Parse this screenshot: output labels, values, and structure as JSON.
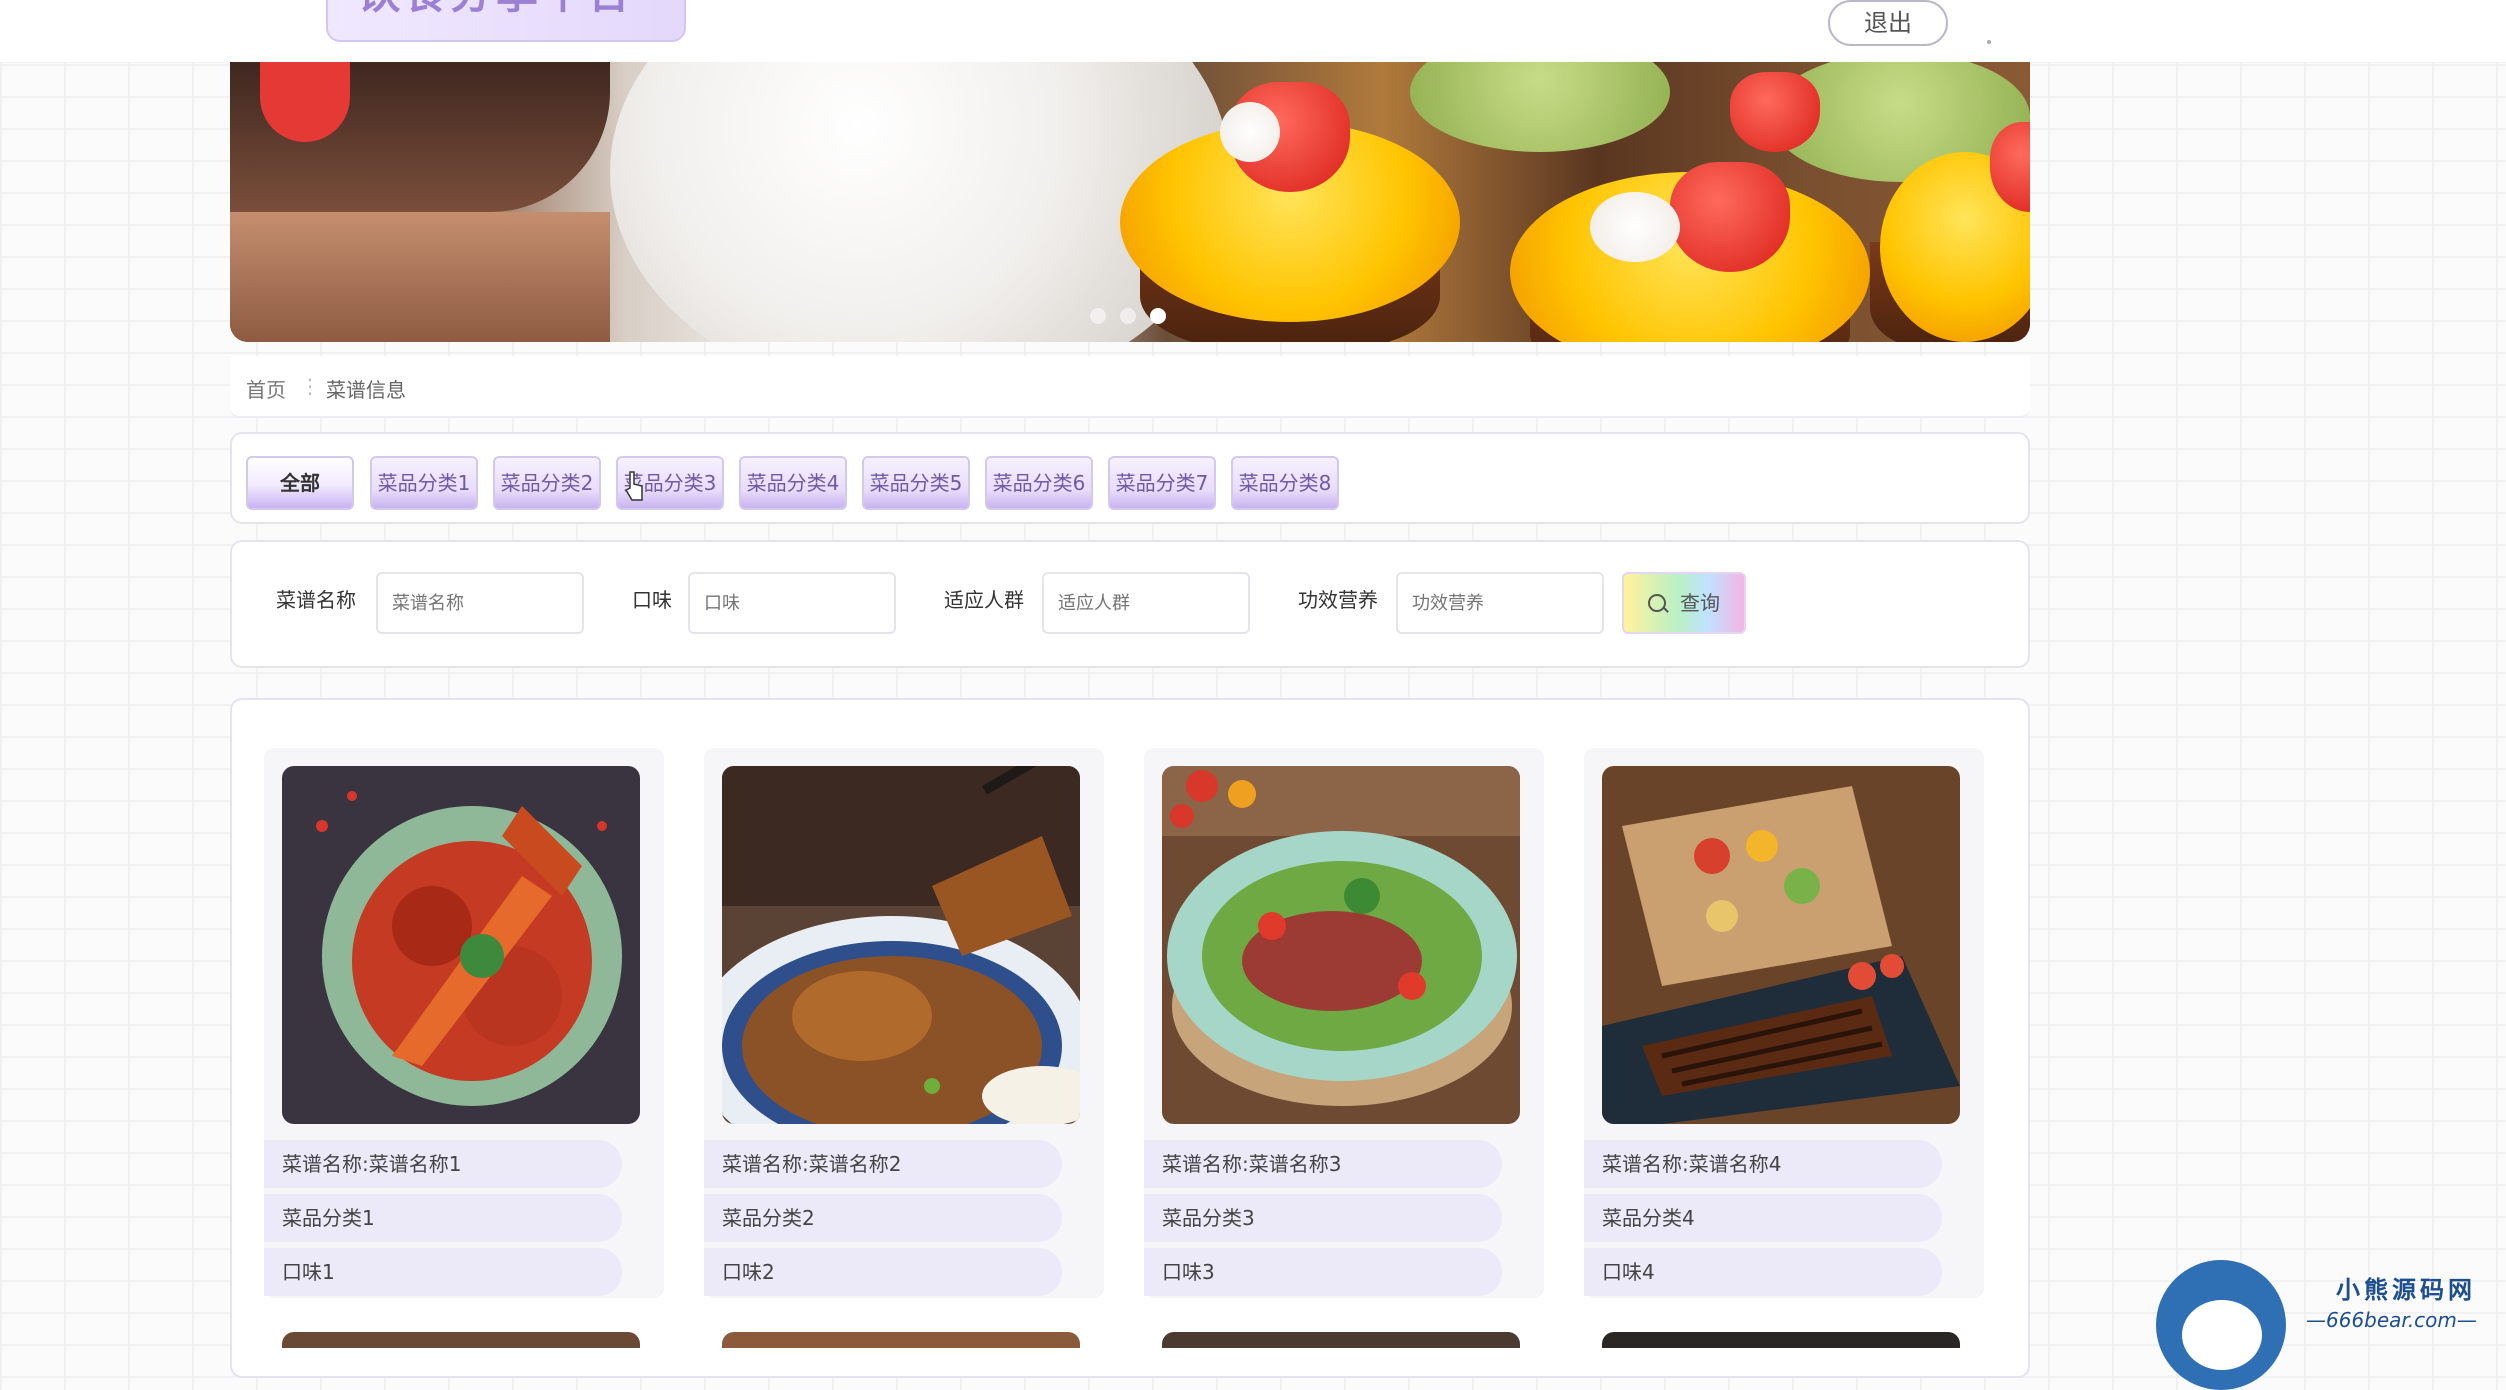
{
  "header": {
    "site_title": "饮食分享平台",
    "logout_label": "退出"
  },
  "banner": {
    "slide_count": 3,
    "active_slide": 3
  },
  "breadcrumb": {
    "home": "首页",
    "separator": "⋮",
    "current": "菜谱信息"
  },
  "categories": [
    {
      "label": "全部",
      "selected": true
    },
    {
      "label": "菜品分类1"
    },
    {
      "label": "菜品分类2"
    },
    {
      "label": "菜品分类3"
    },
    {
      "label": "菜品分类4"
    },
    {
      "label": "菜品分类5"
    },
    {
      "label": "菜品分类6"
    },
    {
      "label": "菜品分类7"
    },
    {
      "label": "菜品分类8"
    }
  ],
  "search": {
    "fields": [
      {
        "label": "菜谱名称",
        "placeholder": "菜谱名称",
        "value": ""
      },
      {
        "label": "口味",
        "placeholder": "口味",
        "value": ""
      },
      {
        "label": "适应人群",
        "placeholder": "适应人群",
        "value": ""
      },
      {
        "label": "功效营养",
        "placeholder": "功效营养",
        "value": ""
      }
    ],
    "button_label": "查询",
    "button_icon": "search-icon"
  },
  "recipes": [
    {
      "name": "菜谱名称:菜谱名称1",
      "category": "菜品分类1",
      "taste": "口味1",
      "image": "crayfish-dish"
    },
    {
      "name": "菜谱名称:菜谱名称2",
      "category": "菜品分类2",
      "taste": "口味2",
      "image": "braised-pork-rice"
    },
    {
      "name": "菜谱名称:菜谱名称3",
      "category": "菜品分类3",
      "taste": "口味3",
      "image": "beef-salad"
    },
    {
      "name": "菜谱名称:菜谱名称4",
      "category": "菜品分类4",
      "taste": "口味4",
      "image": "grilled-eel"
    }
  ],
  "watermark": {
    "title": "小熊源码网",
    "url": "—666bear.com—"
  },
  "colors": {
    "accent_purple": "#c8b3ef",
    "card_field_bg": "#ece9f8"
  }
}
